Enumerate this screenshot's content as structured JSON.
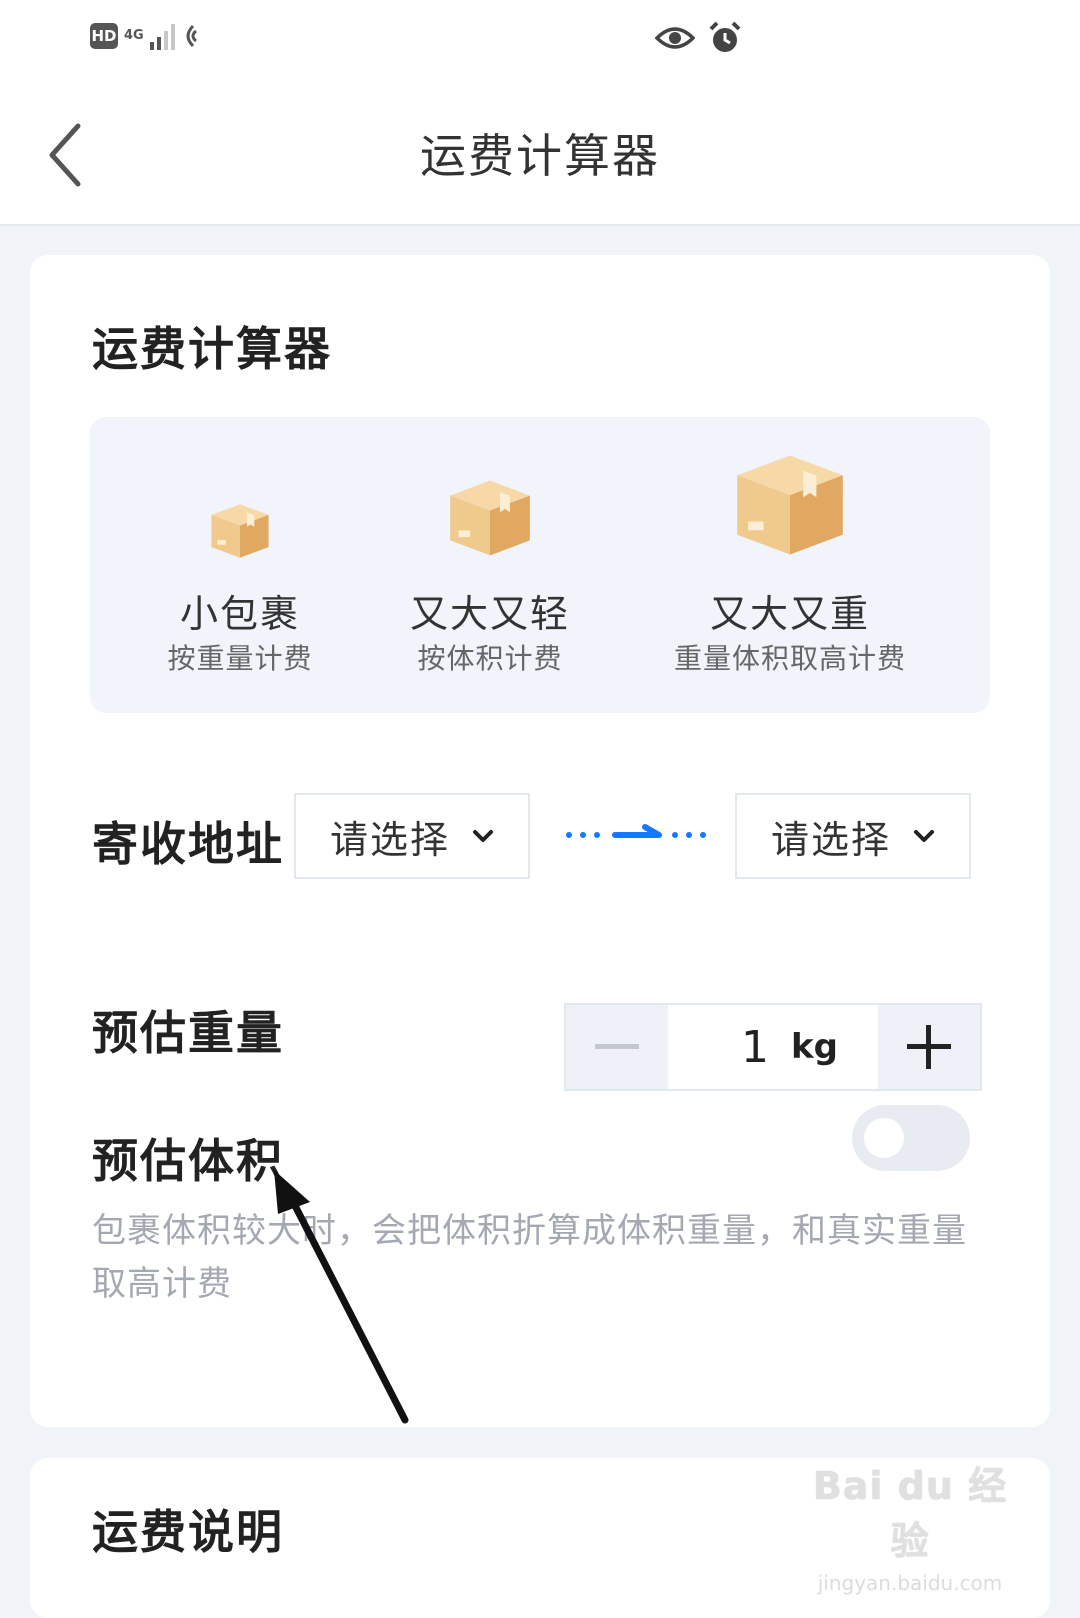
{
  "status_bar": {
    "hd": "HD",
    "network": "4G",
    "icons": [
      "hd-icon",
      "signal-icon",
      "eye-icon",
      "alarm-icon"
    ]
  },
  "header": {
    "title": "运费计算器"
  },
  "calculator": {
    "title": "运费计算器",
    "types": [
      {
        "name": "小包裹",
        "desc": "按重量计费",
        "icon": "small-box-icon"
      },
      {
        "name": "又大又轻",
        "desc": "按体积计费",
        "icon": "medium-box-icon"
      },
      {
        "name": "又大又重",
        "desc": "重量体积取高计费",
        "icon": "large-box-icon"
      }
    ],
    "address": {
      "label": "寄收地址",
      "from_placeholder": "请选择",
      "to_placeholder": "请选择"
    },
    "weight": {
      "label": "预估重量",
      "value": "1",
      "unit": "kg"
    },
    "volume": {
      "label": "预估体积",
      "enabled": false,
      "hint": "包裹体积较大时，会把体积折算成体积重量，和真实重量取高计费"
    }
  },
  "explanation": {
    "title": "运费说明"
  },
  "watermark": {
    "logo": "Bai du 经验",
    "url": "jingyan.baidu.com"
  },
  "colors": {
    "accent": "#1677ff",
    "background": "#f0f4f9",
    "box": "#f0c98d"
  }
}
